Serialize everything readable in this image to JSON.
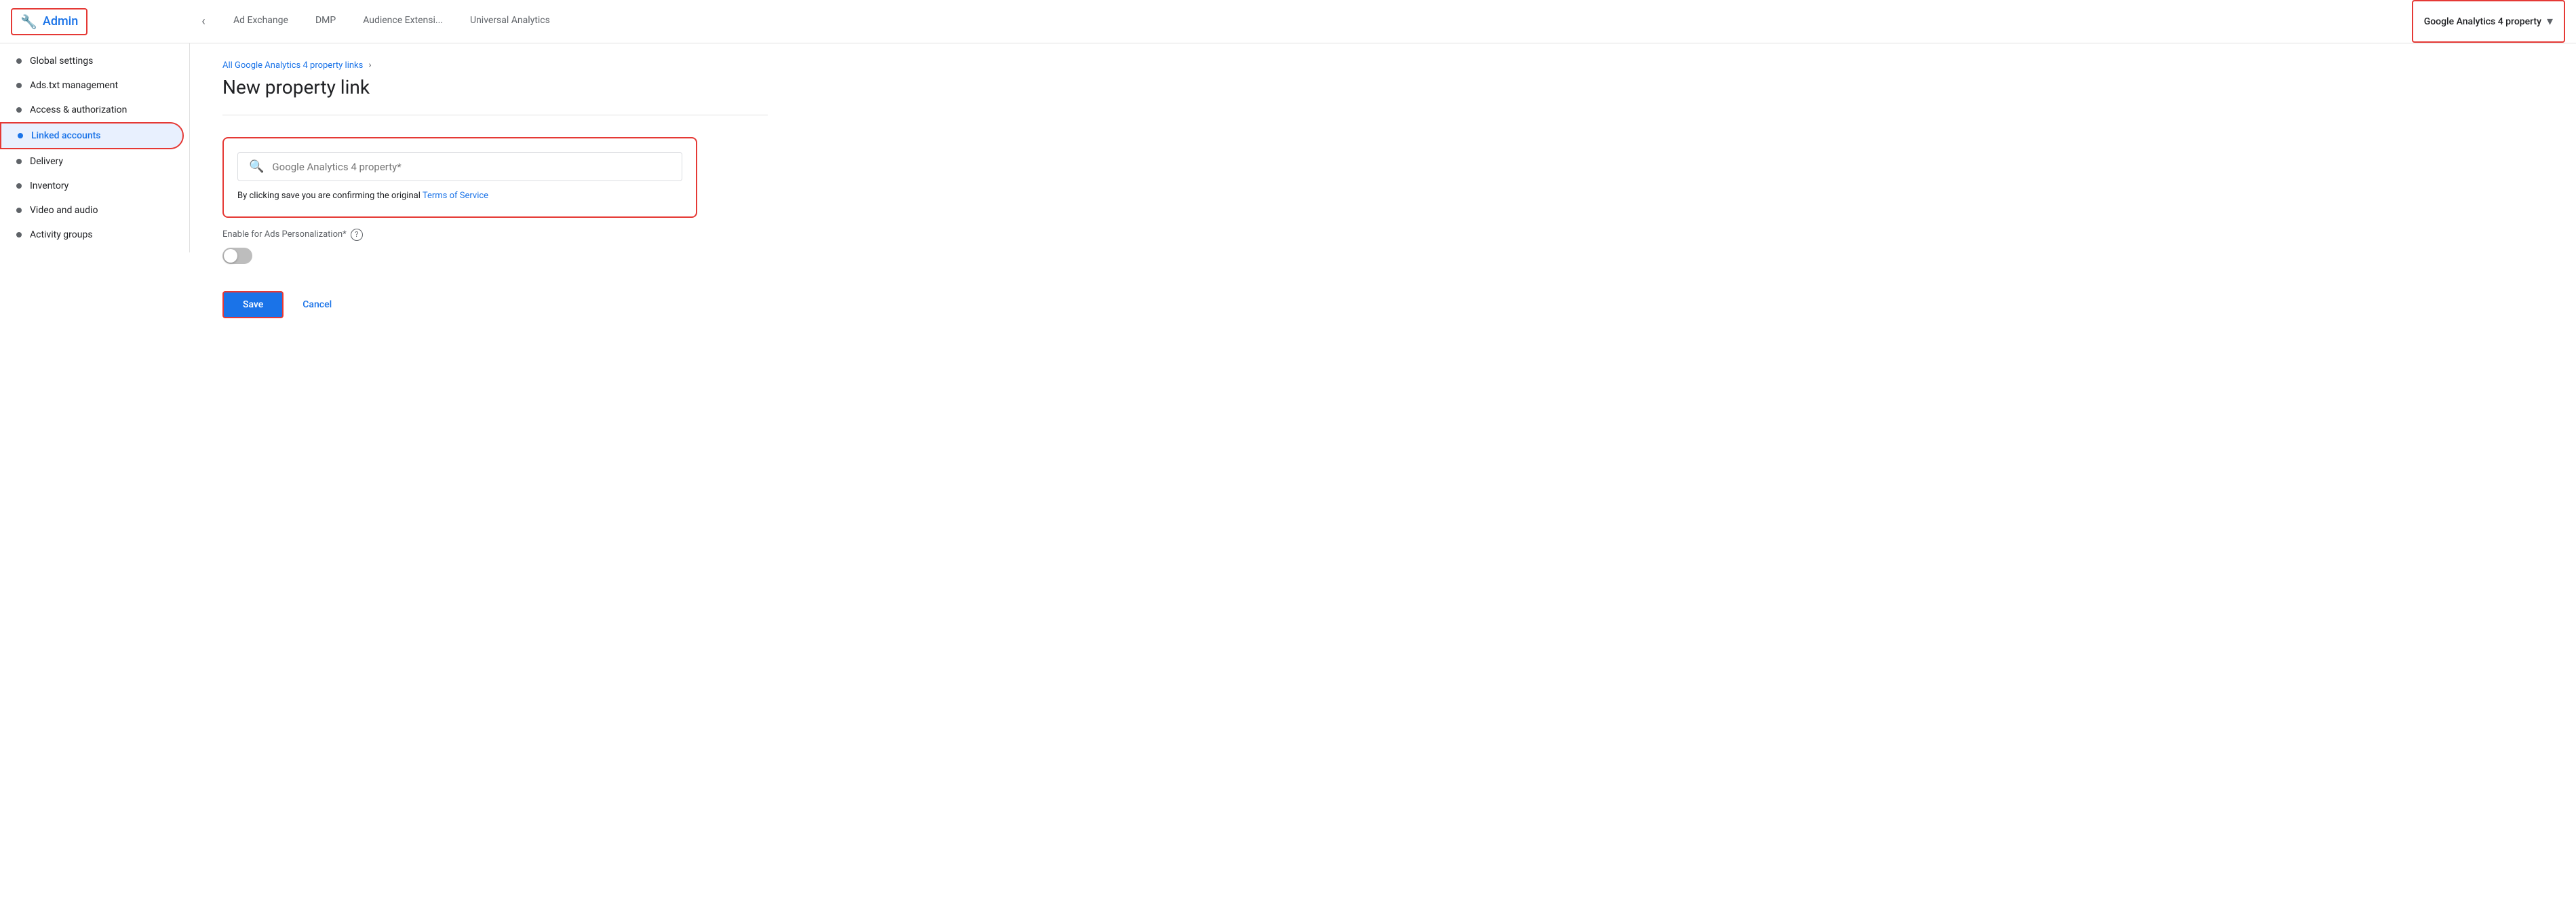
{
  "topnav": {
    "admin_label": "Admin",
    "back_button_label": "‹",
    "tabs": [
      {
        "id": "adx",
        "label": "Ad Exchange",
        "active": false
      },
      {
        "id": "dmp",
        "label": "DMP",
        "active": false
      },
      {
        "id": "audience",
        "label": "Audience Extensi...",
        "active": false
      },
      {
        "id": "universal",
        "label": "Universal Analytics",
        "active": false
      }
    ],
    "dropdown": {
      "label": "Google Analytics 4 property",
      "chevron": "▾"
    }
  },
  "sidebar": {
    "items": [
      {
        "id": "global-settings",
        "label": "Global settings",
        "active": false
      },
      {
        "id": "ads-txt",
        "label": "Ads.txt management",
        "active": false
      },
      {
        "id": "access-auth",
        "label": "Access & authorization",
        "active": false
      },
      {
        "id": "linked-accounts",
        "label": "Linked accounts",
        "active": true
      },
      {
        "id": "delivery",
        "label": "Delivery",
        "active": false
      },
      {
        "id": "inventory",
        "label": "Inventory",
        "active": false
      },
      {
        "id": "video-audio",
        "label": "Video and audio",
        "active": false
      },
      {
        "id": "activity-groups",
        "label": "Activity groups",
        "active": false
      }
    ]
  },
  "content": {
    "breadcrumb_link": "All Google Analytics 4 property links",
    "breadcrumb_sep": "›",
    "page_title": "New property link",
    "search": {
      "placeholder": "Google Analytics 4 property*",
      "search_icon": "🔍"
    },
    "tos_text": "By clicking save you are confirming the original ",
    "tos_link_text": "Terms of Service",
    "toggle_label": "Enable for Ads Personalization*",
    "help_icon_label": "?",
    "save_button": "Save",
    "cancel_button": "Cancel"
  }
}
